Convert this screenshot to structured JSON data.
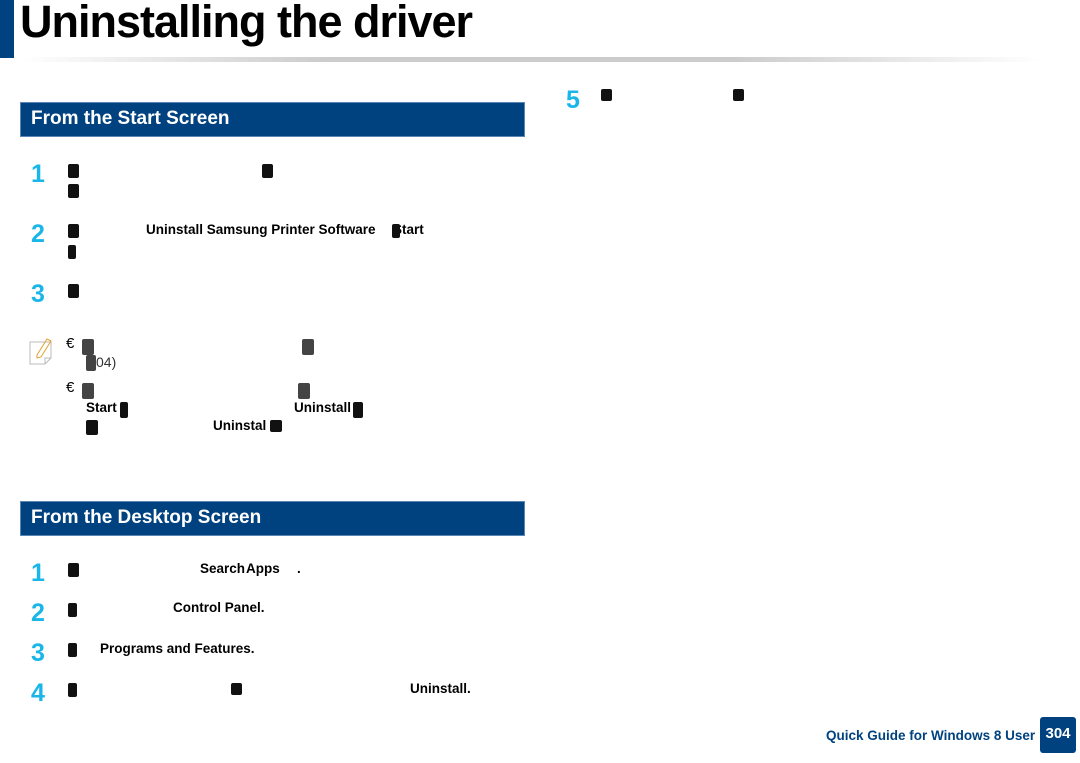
{
  "header": {
    "title": "Uninstalling the driver"
  },
  "start_screen": {
    "heading": "From the Start Screen",
    "steps": [
      {
        "number": "1"
      },
      {
        "number": "2",
        "bold_1": "Uninstall Samsung Printer Software",
        "bold_2": "Start"
      },
      {
        "number": "3"
      }
    ],
    "note": {
      "bullet": "€",
      "item1_tail": "04)",
      "item2_bold_1": "Start",
      "item2_bold_2": "Uninstall",
      "item2_bold_3": "Uninstal"
    }
  },
  "desktop_screen": {
    "heading": "From the Desktop Screen",
    "steps": [
      {
        "number": "1",
        "bold_1": "Search",
        "bold_2": "Apps",
        "tail": "."
      },
      {
        "number": "2",
        "bold_1": "Control Panel."
      },
      {
        "number": "3",
        "bold_1": "Programs and Features."
      },
      {
        "number": "4",
        "bold_1": "Uninstall."
      },
      {
        "number": "5"
      }
    ]
  },
  "footer": {
    "guide_label": "Quick Guide for Windows 8 User",
    "page_number": "304"
  },
  "colors": {
    "brand_blue": "#00427f",
    "step_number": "#1ab6e8"
  }
}
